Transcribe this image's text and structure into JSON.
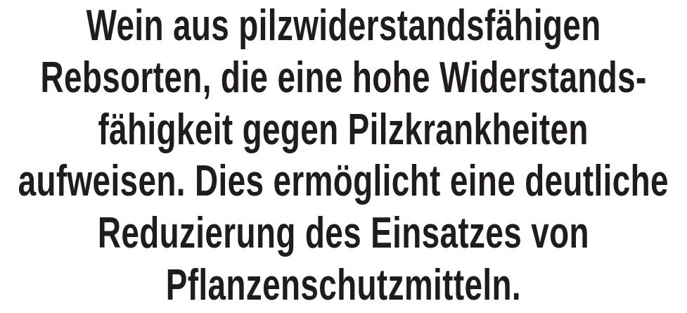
{
  "lines": [
    "Wein aus pilzwiderstandsfähigen",
    "Rebsorten, die eine hohe Widerstands-",
    "fähigkeit gegen Pilzkrankheiten",
    "aufweisen. Dies ermöglicht eine deutliche",
    "Reduzierung des Einsatzes von",
    "Pflanzenschutzmitteln."
  ],
  "colors": {
    "text": "#1f1c1b",
    "background": "#ffffff"
  }
}
